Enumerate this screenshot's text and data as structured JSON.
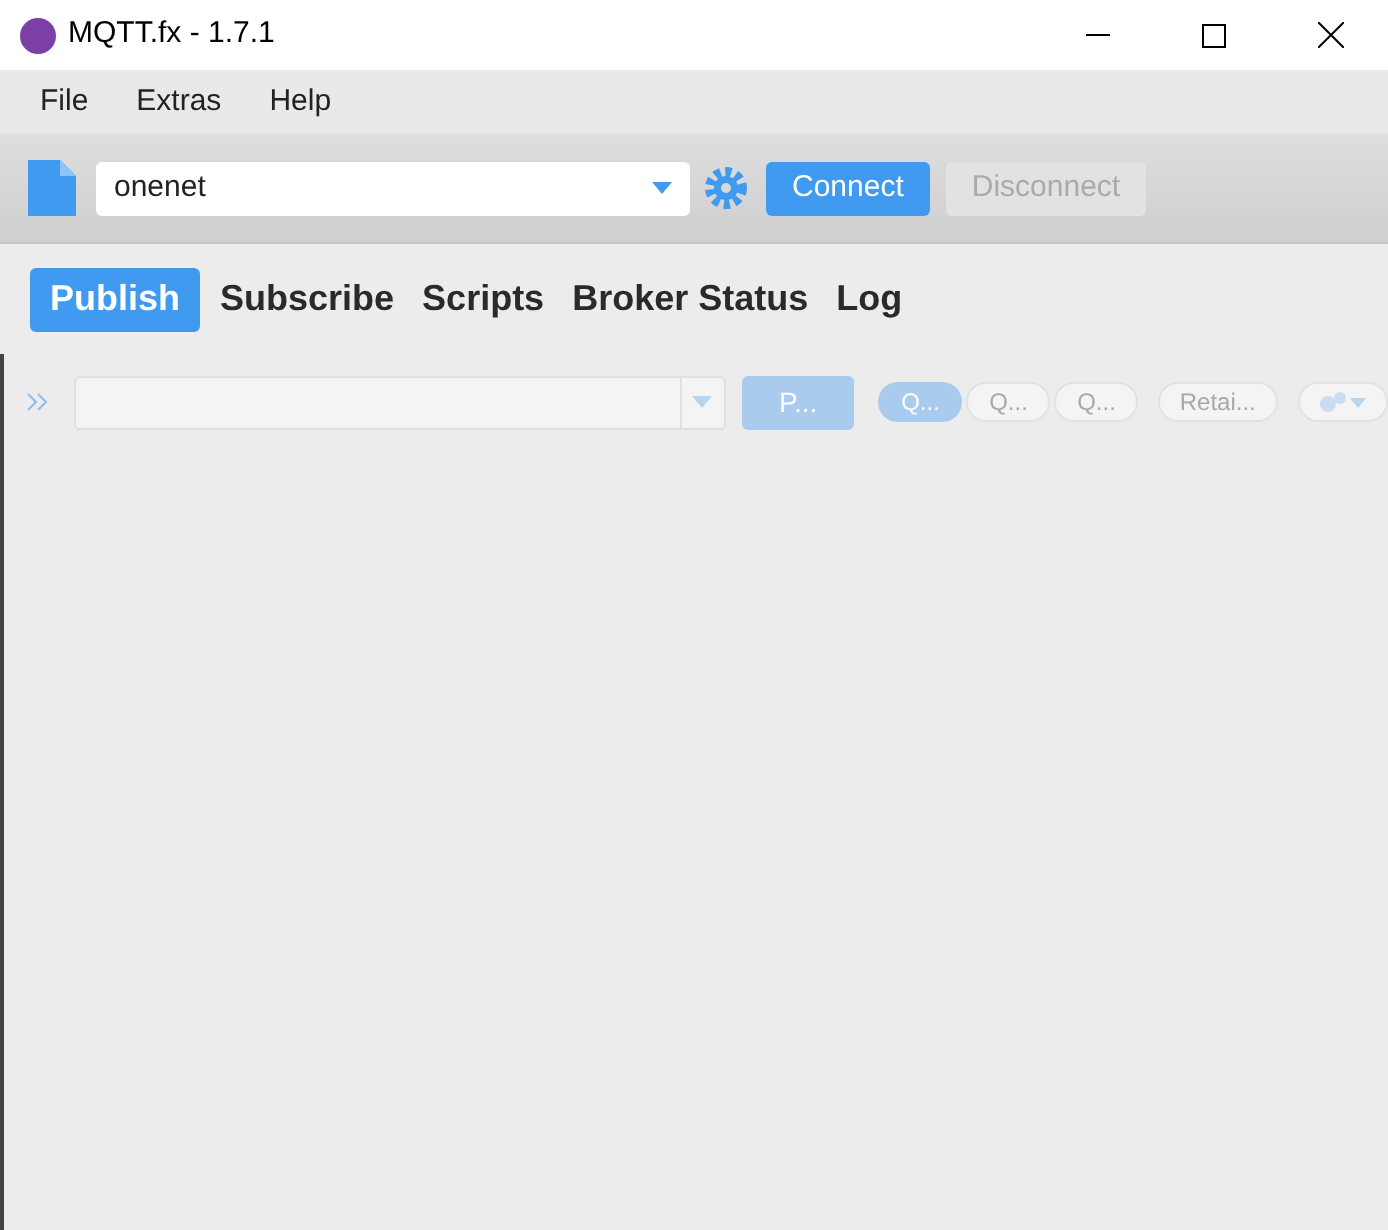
{
  "window": {
    "title": "MQTT.fx - 1.7.1"
  },
  "menu": [
    "File",
    "Extras",
    "Help"
  ],
  "connection": {
    "profile": "onenet",
    "buttons": [
      {
        "label": "Connect",
        "disabled": false
      },
      {
        "label": "Disconnect",
        "disabled": true
      }
    ]
  },
  "tabs": [
    {
      "label": "Publish",
      "selected": true
    },
    {
      "label": "Subscribe",
      "selected": false
    },
    {
      "label": "Scripts",
      "selected": false
    },
    {
      "label": "Broker Status",
      "selected": false
    },
    {
      "label": "Log",
      "selected": false
    }
  ],
  "publish_bar": {
    "disabled": true,
    "button": "P...",
    "qos": [
      {
        "label": "Q...",
        "selected": true
      },
      {
        "label": "Q...",
        "selected": false
      },
      {
        "label": "Q...",
        "selected": false
      }
    ],
    "retain": "Retai..."
  }
}
